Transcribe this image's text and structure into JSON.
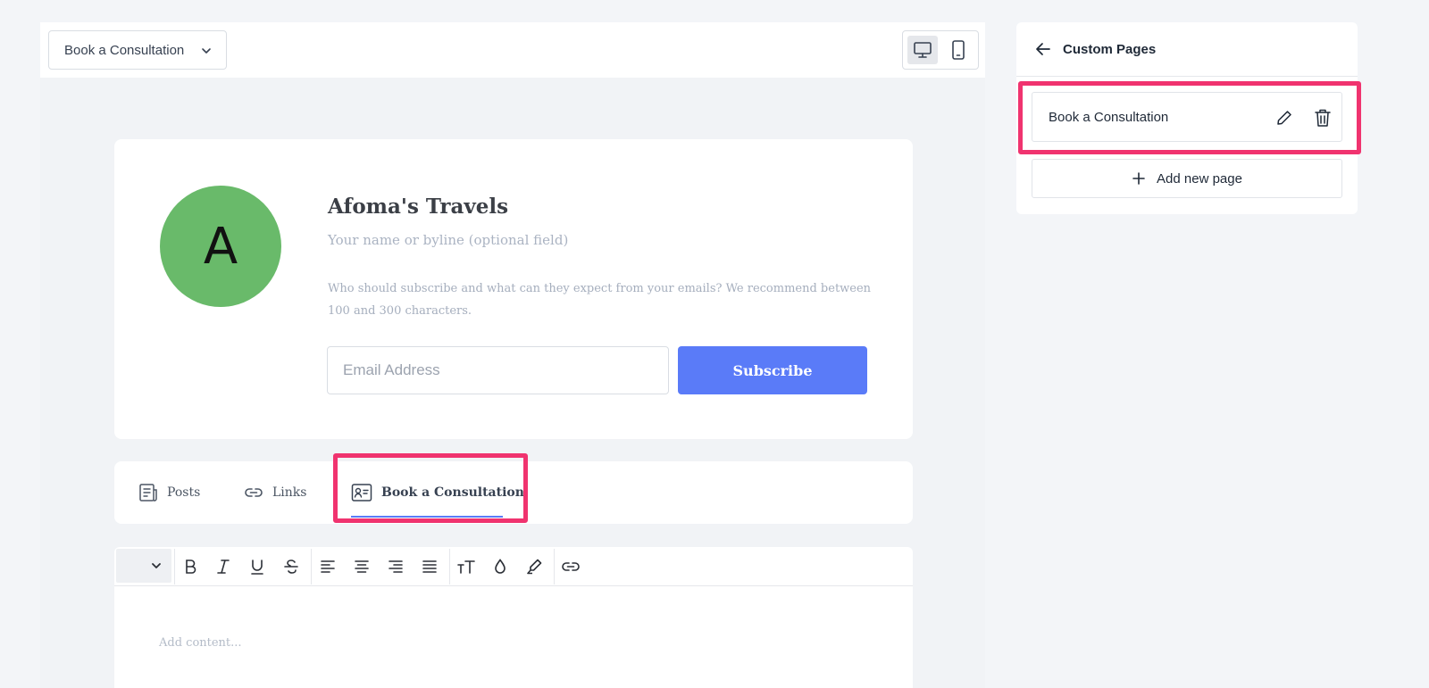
{
  "editor": {
    "page_select": {
      "value": "Book a Consultation"
    },
    "device_toggle": {
      "desktop_icon": "desktop-icon",
      "mobile_icon": "mobile-icon",
      "active": "desktop"
    }
  },
  "profile": {
    "avatar_letter": "A",
    "avatar_color": "#69ba6a",
    "title": "Afoma's Travels",
    "byline_placeholder": "Your name or byline (optional field)",
    "description_placeholder": "Who should subscribe and what can they expect from your emails? We recommend between 100 and 300 characters.",
    "email_placeholder": "Email Address",
    "subscribe_label": "Subscribe",
    "accent_color": "#5a7bf8"
  },
  "tabs": [
    {
      "label": "Posts",
      "icon": "posts-icon"
    },
    {
      "label": "Links",
      "icon": "link-icon"
    },
    {
      "label": "Book a Consultation",
      "icon": "contact-card-icon",
      "active": true
    }
  ],
  "toolbar": {
    "buttons": [
      "bold-icon",
      "italic-icon",
      "underline-icon",
      "strikethrough-icon",
      "align-left-icon",
      "align-center-icon",
      "align-right-icon",
      "align-justify-icon",
      "text-size-icon",
      "color-drop-icon",
      "highlighter-icon",
      "link-icon"
    ]
  },
  "content": {
    "placeholder": "Add content..."
  },
  "panel": {
    "title": "Custom Pages",
    "pages": [
      {
        "name": "Book a Consultation"
      }
    ],
    "add_label": "Add new page"
  },
  "highlight_color": "#f0336f"
}
